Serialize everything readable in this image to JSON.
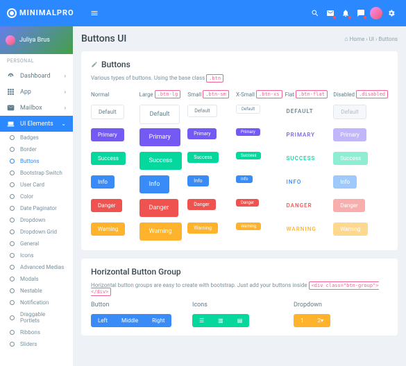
{
  "brand": "MINIMALPRO",
  "user": {
    "name": "Juliya Brus"
  },
  "sidebar": {
    "section": "PERSONAL",
    "items": [
      {
        "label": "Dashboard",
        "icon": "gauge"
      },
      {
        "label": "App",
        "icon": "grid"
      },
      {
        "label": "Mailbox",
        "icon": "mail"
      },
      {
        "label": "UI Elements",
        "icon": "laptop",
        "active": true
      }
    ],
    "subs": [
      "Badges",
      "Border",
      "Buttons",
      "Bootstrap Switch",
      "User Card",
      "Color",
      "Date Paginator",
      "Dropdown",
      "Dropdown Grid",
      "General",
      "Icons",
      "Advanced Medias",
      "Modals",
      "Nestable",
      "Notification",
      "Draggable Portlets",
      "Ribbons",
      "Sliders"
    ]
  },
  "page": {
    "title": "Buttons UI",
    "crumbs": [
      "Home",
      "UI",
      "Buttons"
    ]
  },
  "buttons_card": {
    "title": "Buttons",
    "sub_pre": "Various types of buttons. Using the base class",
    "sub_code": ".btn",
    "cols": [
      {
        "label": "Normal",
        "code": ""
      },
      {
        "label": "Large",
        "code": ".btn-lg"
      },
      {
        "label": "Small",
        "code": ".btn-sm"
      },
      {
        "label": "X-Small",
        "code": ".btn-xs"
      },
      {
        "label": "Flat",
        "code": ".btn-flat"
      },
      {
        "label": "Disabled",
        "code": ".disabled"
      }
    ],
    "rows": [
      "Default",
      "Primary",
      "Success",
      "Info",
      "Danger",
      "Warning"
    ]
  },
  "hgroup": {
    "title": "Horizontal Button Group",
    "sub_pre": "Horizontal button groups are easy to create with bootstrap. Just add your buttons inside",
    "sub_code": "<div class=\"btn-group\"></div>",
    "cols": [
      "Button",
      "Icons",
      "Dropdown"
    ],
    "btns": [
      "Left",
      "Middle",
      "Right"
    ],
    "dd": [
      "1",
      "2"
    ]
  }
}
